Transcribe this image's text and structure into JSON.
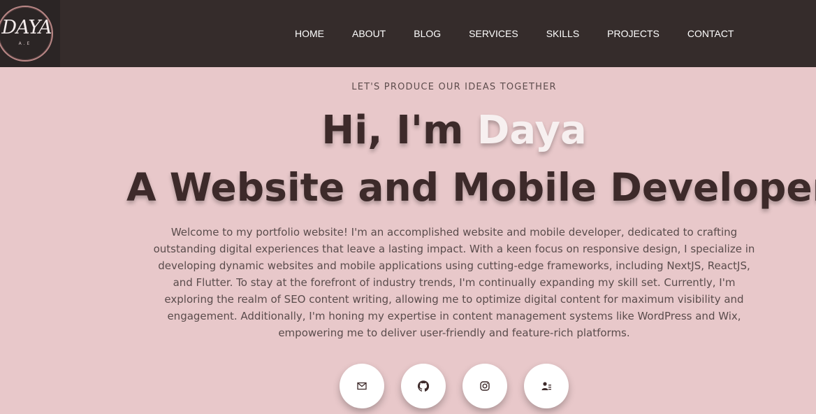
{
  "logo": {
    "text": "DAYA",
    "sub": "A.E"
  },
  "nav": [
    "HOME",
    "ABOUT",
    "BLOG",
    "SERVICES",
    "SKILLS",
    "PROJECTS",
    "CONTACT"
  ],
  "hero": {
    "tagline": "LET'S PRODUCE OUR IDEAS TOGETHER",
    "greeting": "Hi, I'm",
    "name": "Daya",
    "role": "A Website and Mobile Developer",
    "intro": "Welcome to my portfolio website! I'm an accomplished website and mobile developer, dedicated to crafting outstanding digital experiences that leave a lasting impact. With a keen focus on responsive design, I specialize in developing dynamic websites and mobile applications using cutting-edge frameworks, including NextJS, ReactJS, and Flutter. To stay at the forefront of industry trends, I'm continually expanding my skill set. Currently, I'm exploring the realm of SEO content writing, allowing me to optimize digital content for maximum visibility and engagement. Additionally, I'm honing my expertise in content management systems like WordPress and Wix, empowering me to deliver user-friendly and feature-rich platforms."
  },
  "socials": [
    "mail-icon",
    "github-icon",
    "instagram-icon",
    "contact-card-icon"
  ],
  "colors": {
    "header": "#352c2b",
    "background": "#e8c8ca",
    "heading": "#3d2a2a",
    "accent_name": "#f7f0f0"
  }
}
